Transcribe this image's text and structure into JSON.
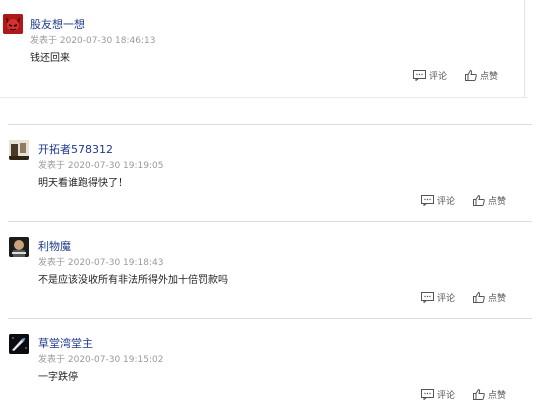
{
  "comments": [
    {
      "user": "股友想一想",
      "time": "发表于 2020-07-30 18:46:13",
      "text": "钱还回来",
      "comment_label": "评论",
      "like_label": "点赞"
    },
    {
      "user": "开拓者578312",
      "time": "发表于 2020-07-30 19:19:05",
      "text": "明天看谁跑得快了！",
      "comment_label": "评论",
      "like_label": "点赞"
    },
    {
      "user": "利物魔",
      "time": "发表于 2020-07-30 19:18:43",
      "text": "不是应该没收所有非法所得外加十倍罚款吗",
      "comment_label": "评论",
      "like_label": "点赞"
    },
    {
      "user": "草堂湾堂主",
      "time": "发表于 2020-07-30 19:15:02",
      "text": "一字跌停",
      "comment_label": "评论",
      "like_label": "点赞"
    }
  ],
  "icons": {
    "comment": "comment-icon",
    "like": "thumbs-up-icon"
  }
}
